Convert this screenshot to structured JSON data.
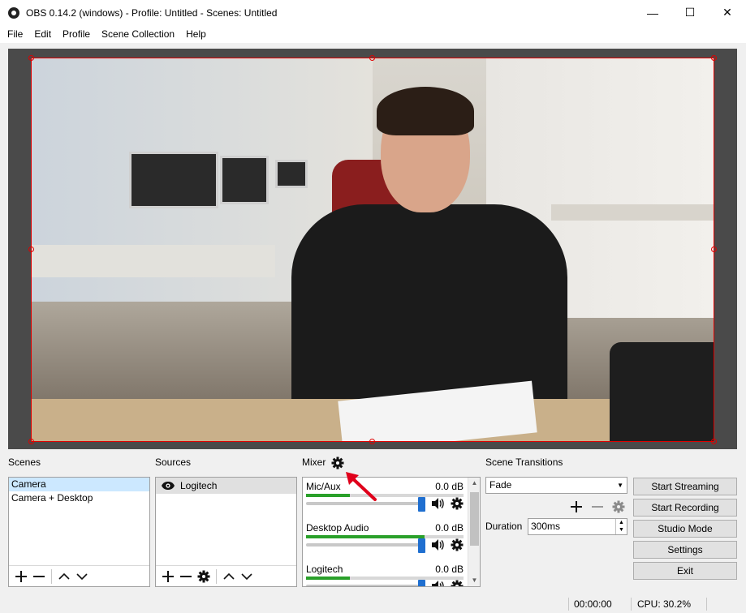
{
  "window": {
    "title": "OBS 0.14.2 (windows) - Profile: Untitled - Scenes: Untitled",
    "minimize": "—",
    "maximize": "☐",
    "close": "✕"
  },
  "menu": [
    {
      "label": "File"
    },
    {
      "label": "Edit"
    },
    {
      "label": "Profile"
    },
    {
      "label": "Scene Collection"
    },
    {
      "label": "Help"
    }
  ],
  "scenes": {
    "title": "Scenes",
    "items": [
      {
        "label": "Camera",
        "selected": true
      },
      {
        "label": "Camera + Desktop",
        "selected": false
      }
    ]
  },
  "sources": {
    "title": "Sources",
    "items": [
      {
        "label": "Logitech",
        "visible": true
      }
    ]
  },
  "mixer": {
    "title": "Mixer",
    "channels": [
      {
        "name": "Mic/Aux",
        "db": "0.0 dB",
        "level": 0.28,
        "volume": 1.0
      },
      {
        "name": "Desktop Audio",
        "db": "0.0 dB",
        "level": 0.75,
        "volume": 1.0
      },
      {
        "name": "Logitech",
        "db": "0.0 dB",
        "level": 0.28,
        "volume": 1.0
      }
    ]
  },
  "transitions": {
    "title": "Scene Transitions",
    "selected": "Fade",
    "duration_label": "Duration",
    "duration_value": "300ms"
  },
  "controls": {
    "start_streaming": "Start Streaming",
    "start_recording": "Start Recording",
    "studio_mode": "Studio Mode",
    "settings": "Settings",
    "exit": "Exit"
  },
  "status": {
    "time": "00:00:00",
    "cpu": "CPU: 30.2%"
  },
  "colors": {
    "accent_blue": "#1f6fd0",
    "selection": "#cce8ff",
    "meter_green": "#2aa02a",
    "bounding_red": "#e00000",
    "annotation_red": "#e0001b"
  }
}
